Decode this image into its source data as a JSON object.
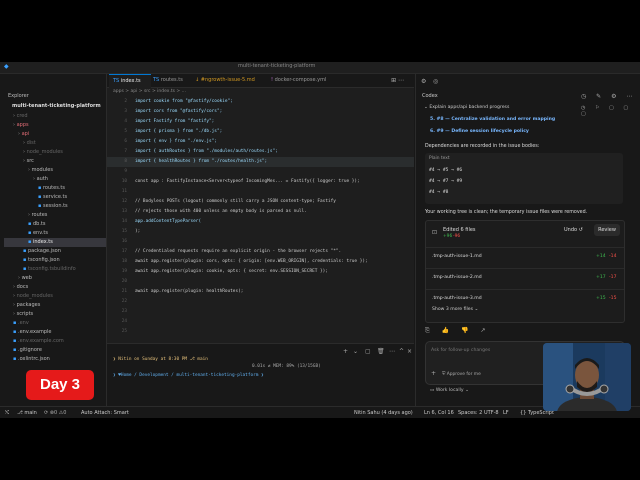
{
  "window": {
    "title": "multi-tenant-ticketing-platform"
  },
  "explorer": {
    "header": "Explorer",
    "root": "multi-tenant-ticketing-platform",
    "items": [
      {
        "label": "cred",
        "depth": 1,
        "type": "folder",
        "state": "dim"
      },
      {
        "label": "apps",
        "depth": 1,
        "type": "folder",
        "state": "red"
      },
      {
        "label": "api",
        "depth": 2,
        "type": "folder",
        "state": "red"
      },
      {
        "label": "dist",
        "depth": 3,
        "type": "folder",
        "state": "dim"
      },
      {
        "label": "node_modules",
        "depth": 3,
        "type": "folder",
        "state": "dim"
      },
      {
        "label": "src",
        "depth": 3,
        "type": "folder",
        "state": ""
      },
      {
        "label": "modules",
        "depth": 4,
        "type": "folder",
        "state": ""
      },
      {
        "label": "auth",
        "depth": 5,
        "type": "folder",
        "state": ""
      },
      {
        "label": "routes.ts",
        "depth": 6,
        "type": "file",
        "state": ""
      },
      {
        "label": "service.ts",
        "depth": 6,
        "type": "file",
        "state": ""
      },
      {
        "label": "session.ts",
        "depth": 6,
        "type": "file",
        "state": ""
      },
      {
        "label": "routes",
        "depth": 4,
        "type": "folder",
        "state": ""
      },
      {
        "label": "db.ts",
        "depth": 4,
        "type": "file",
        "state": ""
      },
      {
        "label": "env.ts",
        "depth": 4,
        "type": "file",
        "state": ""
      },
      {
        "label": "index.ts",
        "depth": 4,
        "type": "file",
        "state": "sel"
      },
      {
        "label": "package.json",
        "depth": 3,
        "type": "file",
        "state": ""
      },
      {
        "label": "tsconfig.json",
        "depth": 3,
        "type": "file",
        "state": ""
      },
      {
        "label": "tsconfig.tsbuildinfo",
        "depth": 3,
        "type": "file",
        "state": "dim"
      },
      {
        "label": "web",
        "depth": 2,
        "type": "folder",
        "state": ""
      },
      {
        "label": "docs",
        "depth": 1,
        "type": "folder",
        "state": ""
      },
      {
        "label": "node_modules",
        "depth": 1,
        "type": "folder",
        "state": "dim"
      },
      {
        "label": "packages",
        "depth": 1,
        "type": "folder",
        "state": ""
      },
      {
        "label": "scripts",
        "depth": 1,
        "type": "folder",
        "state": ""
      },
      {
        "label": ".env",
        "depth": 1,
        "type": "file",
        "state": "dim"
      },
      {
        "label": ".env.example",
        "depth": 1,
        "type": "file",
        "state": ""
      },
      {
        "label": ".env.example.com",
        "depth": 1,
        "type": "file",
        "state": "dim"
      },
      {
        "label": ".gitignore",
        "depth": 1,
        "type": "file",
        "state": ""
      },
      {
        "label": ".oxlintrc.json",
        "depth": 1,
        "type": "file",
        "state": ""
      }
    ]
  },
  "editor": {
    "tabs": [
      {
        "label": "index.ts",
        "active": true
      },
      {
        "label": "routes.ts",
        "active": false
      },
      {
        "label": "#ngrowth-issue-5.md",
        "active": false
      },
      {
        "label": "docker-compose.yml",
        "active": false
      }
    ],
    "breadcrumb": "apps > api > src > index.ts > ...",
    "lines": [
      {
        "n": "2",
        "text": "import cookie from \"@fastify/cookie\";",
        "kind": "kw"
      },
      {
        "n": "3",
        "text": "import cors from \"@fastify/cors\";",
        "kind": "kw"
      },
      {
        "n": "4",
        "text": "import Fastify from \"fastify\";",
        "kind": "kw"
      },
      {
        "n": "5",
        "text": "import { prisma } from \"./db.js\";",
        "kind": "kw"
      },
      {
        "n": "6",
        "text": "import { env } from \"./env.js\";",
        "kind": "kw"
      },
      {
        "n": "7",
        "text": "import { authRoutes } from \"./modules/auth/routes.js\";",
        "kind": "kw"
      },
      {
        "n": "8",
        "text": "import { healthRoutes } from \"./routes/health.js\";",
        "kind": "hl"
      },
      {
        "n": "9",
        "text": "",
        "kind": ""
      },
      {
        "n": "10",
        "text": "const app : FastifyInstance<Server<typeof IncomingMes... = Fastify({ logger: true });",
        "kind": ""
      },
      {
        "n": "11",
        "text": "",
        "kind": ""
      },
      {
        "n": "12",
        "text": "// Bodyless POSTs (logout) commonly still carry a JSON content-type; Fastify",
        "kind": "cm"
      },
      {
        "n": "13",
        "text": "// rejects those with 400 unless an empty body is parsed as null.",
        "kind": "cm"
      },
      {
        "n": "14",
        "text": "app.addContentTypeParser(",
        "kind": "kw"
      },
      {
        "n": "15",
        "text": ");",
        "kind": ""
      },
      {
        "n": "16",
        "text": "",
        "kind": ""
      },
      {
        "n": "17",
        "text": "// Credentialed requests require an explicit origin - the browser rejects \"*\".",
        "kind": "cm"
      },
      {
        "n": "18",
        "text": "await app.register(plugin: cors, opts: { origin: [env.WEB_ORIGIN], credentials: true });",
        "kind": ""
      },
      {
        "n": "19",
        "text": "await app.register(plugin: cookie, opts: { secret: env.SESSION_SECRET });",
        "kind": ""
      },
      {
        "n": "20",
        "text": "",
        "kind": ""
      },
      {
        "n": "21",
        "text": "await app.register(plugin: healthRoutes);",
        "kind": ""
      },
      {
        "n": "22",
        "text": "",
        "kind": ""
      },
      {
        "n": "23",
        "text": "",
        "kind": ""
      },
      {
        "n": "24",
        "text": "",
        "kind": ""
      },
      {
        "n": "25",
        "text": "",
        "kind": ""
      }
    ]
  },
  "terminal": {
    "line1": "❯ Nitin on Sunday at 8:30 PM  ⎇ main",
    "line1_right": "0.01s ≠ MEM: 89% (13/15GB)",
    "line2": "❯ ♥Home / Development / multi-tenant-ticketing-platform ❯"
  },
  "codex": {
    "title": "Codex",
    "task": "Explain apps/api backend progress",
    "issue5": "5.  #8 — Centralize validation and error mapping",
    "issue6": "6.  #9 — Define session lifecycle policy",
    "deps_text": "Dependencies are recorded in the issue bodies:",
    "code_label": "Plain text",
    "code_lines": [
      "#4 → #5 → #6",
      "#4 → #7 → #9",
      "#4 → #8"
    ],
    "clean_text": "Your working tree is clean; the temporary issue files were removed.",
    "edited_title": "Edited 6 files",
    "edited_added": "+96",
    "edited_removed": "-96",
    "undo_label": "Undo ↺",
    "review_label": "Review",
    "files": [
      {
        "name": ".tmp-auth-issue-1.md",
        "added": "+14",
        "removed": "-14"
      },
      {
        "name": ".tmp-auth-issue-2.md",
        "added": "+17",
        "removed": "-17"
      },
      {
        "name": ".tmp-auth-issue-3.md",
        "added": "+15",
        "removed": "-15"
      }
    ],
    "show_more": "Show 3 more files",
    "input_placeholder": "Ask for follow-up changes",
    "approve_label": "Approve for me",
    "model_label": "5.6 Late",
    "work_label": "Work locally"
  },
  "statusbar": {
    "branch": "main",
    "auto_attach": "Auto Attach: Smart",
    "author": "Nitin Sahu (4 days ago)",
    "position": "Ln 6, Col 16",
    "spaces": "Spaces: 2",
    "encoding": "UTF-8",
    "eol": "LF",
    "language": "{} TypeScript"
  },
  "badge": {
    "label": "Day 3"
  },
  "colors": {
    "accent": "#0078d4",
    "badge": "#e51a1a",
    "link": "#79b8ff",
    "added": "#3fb950",
    "removed": "#f85149"
  }
}
